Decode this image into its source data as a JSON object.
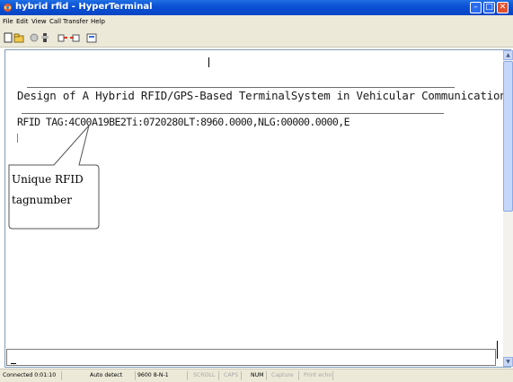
{
  "window": {
    "title": "hybrid rfid - HyperTerminal",
    "minimize_glyph": "–",
    "maximize_glyph": "□",
    "close_glyph": "✕"
  },
  "menu": [
    "File",
    "Edit",
    "View",
    "Call",
    "Transfer",
    "Help"
  ],
  "toolbar": {
    "icons": [
      "new-icon",
      "open-icon",
      "disconnect-icon",
      "connect-icon",
      "send-icon",
      "receive-icon",
      "properties-icon"
    ]
  },
  "terminal": {
    "line1": "Design of A Hybrid RFID/GPS-Based TerminalSystem in Vehicular Communications",
    "line2": "RFID TAG:4C00A19BE2Ti:0720280LT:8960.0000,NLG:00000.0000,E"
  },
  "callout": {
    "line1": "Unique RFID",
    "line2": "tagnumber"
  },
  "statusbar": {
    "connected": "Connected 0:01:10",
    "detect": "Auto detect",
    "baud": "9600 8-N-1",
    "scroll": "SCROLL",
    "caps": "CAPS",
    "num": "NUM",
    "capture": "Capture",
    "print_echo": "Print echo"
  },
  "colors": {
    "titlebar": "#0a4fd4",
    "chrome": "#ece9d8",
    "terminal_bg": "#ffffff",
    "text": "#1a1a1a"
  }
}
